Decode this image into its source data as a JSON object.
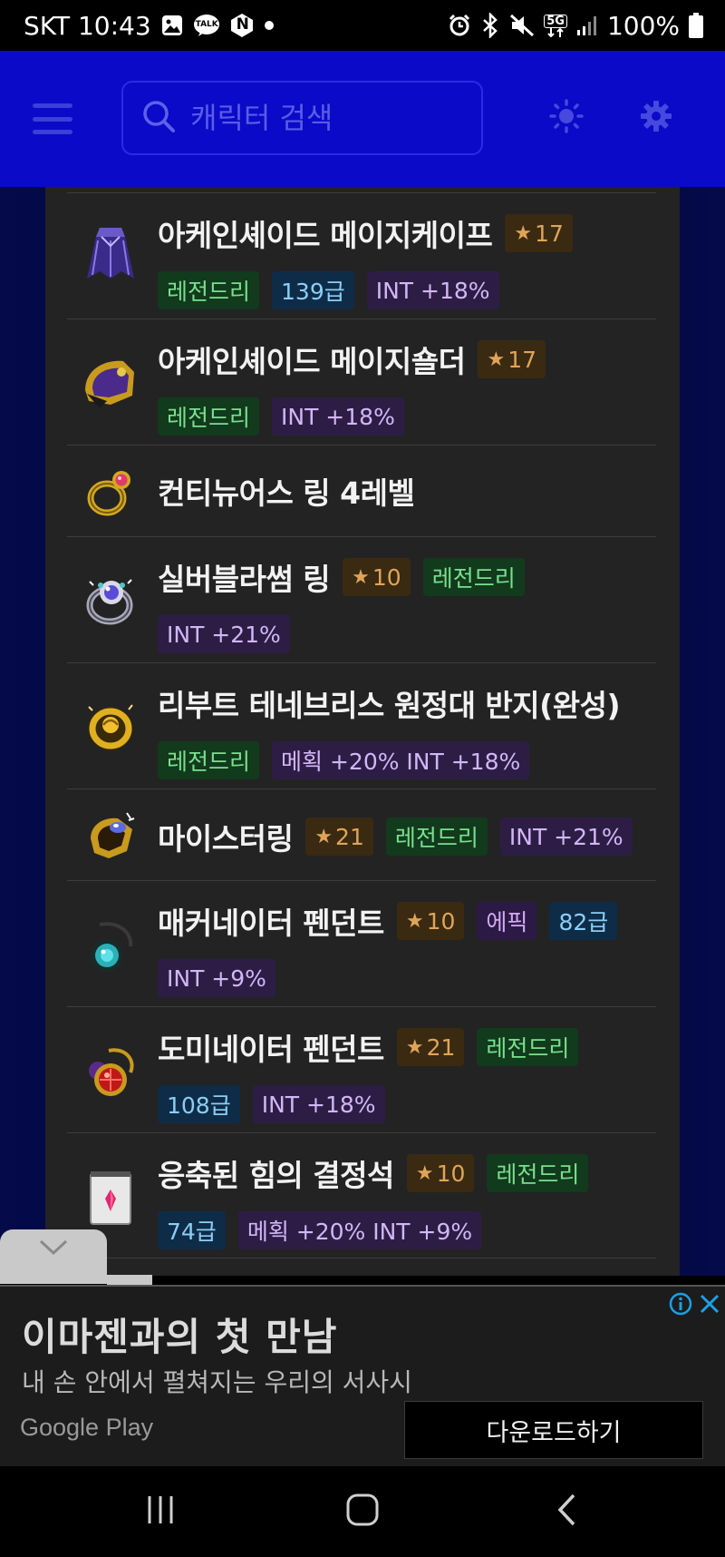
{
  "status_bar": {
    "carrier_time": "SKT 10:43",
    "talk_badge": "TALK",
    "n_badge": "N",
    "net_badge": "5G",
    "battery": "100%"
  },
  "header": {
    "search": {
      "placeholder": "캐릭터 검색",
      "value": ""
    },
    "menu_icon": "hamburger-menu",
    "theme_icon": "sun",
    "settings_icon": "gear"
  },
  "items": [
    {
      "name": "아케인셰이드 메이지케이프",
      "icon": "cape",
      "lines": [
        [
          {
            "kind": "star",
            "text": "17"
          }
        ],
        [
          {
            "kind": "legend",
            "text": "레전드리"
          },
          {
            "kind": "grade",
            "text": "139급"
          },
          {
            "kind": "stat",
            "text": "INT +18%"
          }
        ]
      ]
    },
    {
      "name": "아케인셰이드 메이지숄더",
      "icon": "shoulder",
      "lines": [
        [
          {
            "kind": "star",
            "text": "17"
          }
        ],
        [
          {
            "kind": "legend",
            "text": "레전드리"
          },
          {
            "kind": "stat",
            "text": "INT +18%"
          }
        ]
      ]
    },
    {
      "name": "컨티뉴어스 링 4레벨",
      "icon": "ring-gold",
      "lines": [
        []
      ]
    },
    {
      "name": "실버블라썸 링",
      "icon": "ring-silver",
      "lines": [
        [
          {
            "kind": "star",
            "text": "10"
          },
          {
            "kind": "legend",
            "text": "레전드리"
          }
        ],
        [
          {
            "kind": "stat",
            "text": "INT +21%"
          }
        ]
      ]
    },
    {
      "name": "리부트 테네브리스 원정대 반지(완성)",
      "icon": "ring-tenebris",
      "lines": [
        [],
        [
          {
            "kind": "legend",
            "text": "레전드리"
          },
          {
            "kind": "stat",
            "text": "메획 +20% INT +18%"
          }
        ]
      ]
    },
    {
      "name": "마이스터링",
      "icon": "ring-meister",
      "lines": [
        [
          {
            "kind": "star",
            "text": "21"
          },
          {
            "kind": "legend",
            "text": "레전드리"
          },
          {
            "kind": "stat",
            "text": "INT +21%"
          }
        ]
      ]
    },
    {
      "name": "매커네이터 펜던트",
      "icon": "pendant-teal",
      "lines": [
        [
          {
            "kind": "star",
            "text": "10"
          },
          {
            "kind": "epic",
            "text": "에픽"
          },
          {
            "kind": "grade",
            "text": "82급"
          }
        ],
        [
          {
            "kind": "stat",
            "text": "INT +9%"
          }
        ]
      ]
    },
    {
      "name": "도미네이터 펜던트",
      "icon": "pendant-red",
      "lines": [
        [
          {
            "kind": "star",
            "text": "21"
          },
          {
            "kind": "legend",
            "text": "레전드리"
          }
        ],
        [
          {
            "kind": "grade",
            "text": "108급"
          },
          {
            "kind": "stat",
            "text": "INT +18%"
          }
        ]
      ]
    },
    {
      "name": "응축된 힘의 결정석",
      "icon": "crystal-card",
      "lines": [
        [
          {
            "kind": "star",
            "text": "10"
          },
          {
            "kind": "legend",
            "text": "레전드리"
          }
        ],
        [
          {
            "kind": "grade",
            "text": "74급"
          },
          {
            "kind": "stat",
            "text": "메획 +20% INT +9%"
          }
        ]
      ]
    }
  ],
  "ad": {
    "title": "이마젠과의 첫 만남",
    "subtitle": "내 손 안에서 펼쳐지는 우리의 서사시",
    "source": "Google Play",
    "cta": "다운로드하기",
    "info_icon": "info",
    "close_icon": "close"
  },
  "colors": {
    "header_bg": "#0a0ac8",
    "panel_bg": "#232323",
    "star": "#e0a458",
    "legendary": "#79e08e",
    "epic": "#d2a8f4",
    "grade": "#8ccdf4",
    "stat": "#d2b6f6"
  }
}
